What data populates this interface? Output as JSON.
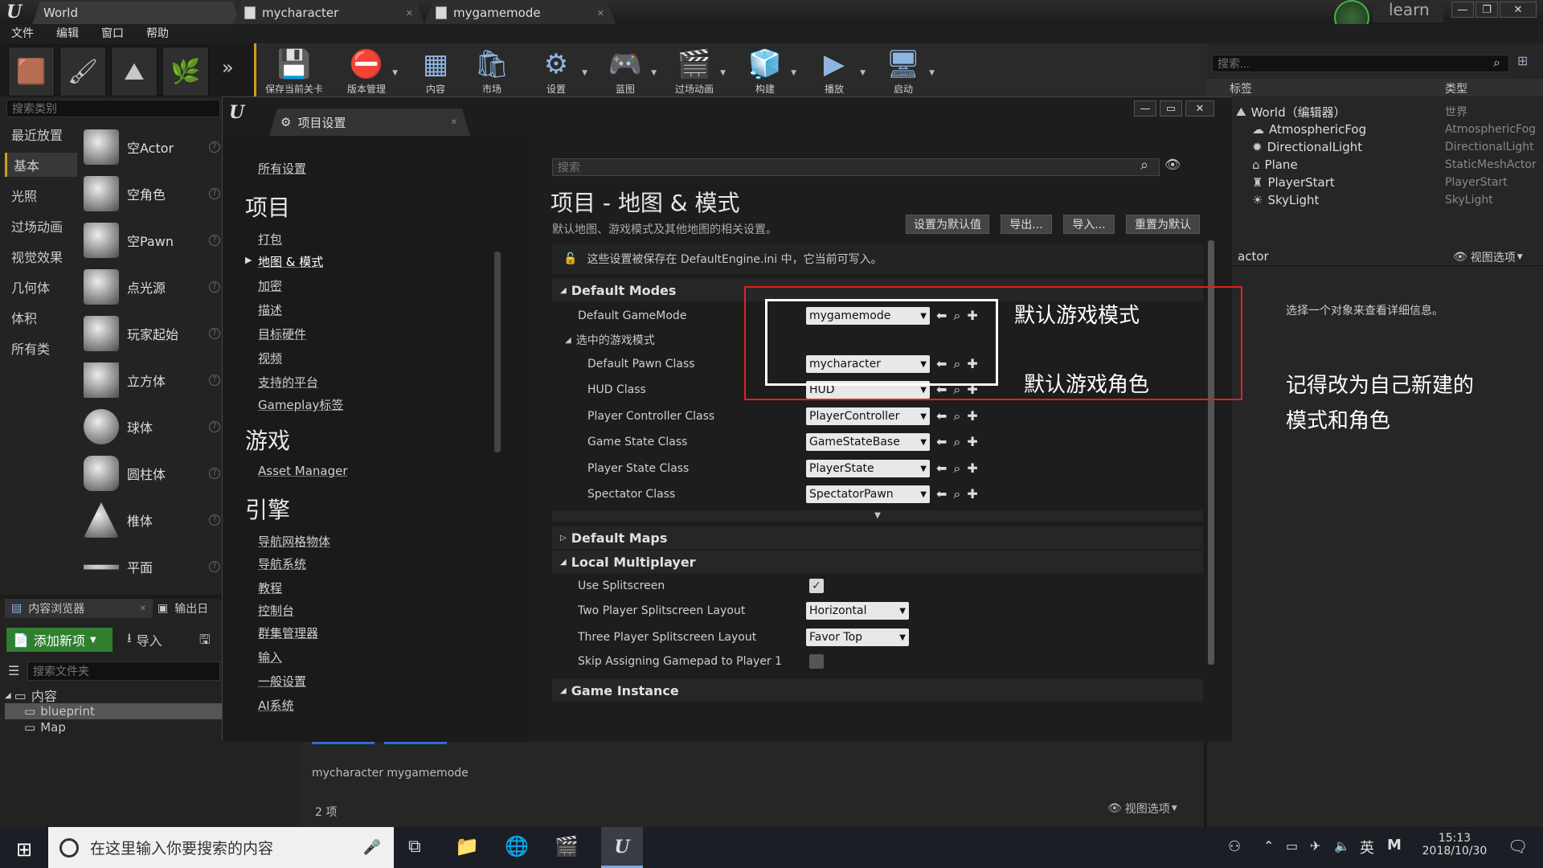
{
  "titlebar": {
    "tabs": [
      "World",
      "mycharacter",
      "mygamemode"
    ],
    "learn": "learn"
  },
  "menu": [
    "文件",
    "编辑",
    "窗口",
    "帮助"
  ],
  "toolbar": {
    "buttons": [
      "保存当前关卡",
      "版本管理",
      "内容",
      "市场",
      "设置",
      "蓝图",
      "过场动画",
      "构建",
      "播放",
      "启动"
    ]
  },
  "left": {
    "search_placeholder": "搜索类别",
    "categories": [
      "最近放置",
      "基本",
      "光照",
      "过场动画",
      "视觉效果",
      "几何体",
      "体积",
      "所有类"
    ],
    "items": [
      "空Actor",
      "空角色",
      "空Pawn",
      "点光源",
      "玩家起始",
      "立方体",
      "球体",
      "圆柱体",
      "椎体",
      "平面"
    ]
  },
  "content": {
    "tabs": [
      "内容浏览器",
      "输出日"
    ],
    "add_new": "添加新项",
    "import": "导入",
    "search_placeholder": "搜索文件夹",
    "tree": {
      "root": "内容",
      "children": [
        "blueprint",
        "Map"
      ]
    },
    "assets": "mycharacter  mygamemode",
    "count": "2 项",
    "view_options": "视图选项"
  },
  "outliner": {
    "search_placeholder": "搜索...",
    "col_label": "标签",
    "col_type": "类型",
    "rows": [
      {
        "label": "World（编辑器）",
        "type": "世界"
      },
      {
        "label": "AtmosphericFog",
        "type": "AtmosphericFog"
      },
      {
        "label": "DirectionalLight",
        "type": "DirectionalLight"
      },
      {
        "label": "Plane",
        "type": "StaticMeshActor"
      },
      {
        "label": "PlayerStart",
        "type": "PlayerStart"
      },
      {
        "label": "SkyLight",
        "type": "SkyLight"
      }
    ],
    "footer_left": "actor",
    "footer_right": "视图选项"
  },
  "details": {
    "hint": "选择一个对象来查看详细信息。",
    "annotation": "记得改为自己新建的\n模式和角色"
  },
  "modal": {
    "tab": "项目设置",
    "all_settings": "所有设置",
    "nav": [
      {
        "head": "项目",
        "links": [
          "打包",
          "地图 & 模式",
          "加密",
          "描述",
          "目标硬件",
          "视频",
          "支持的平台",
          "Gameplay标签"
        ]
      },
      {
        "head": "游戏",
        "links": [
          "Asset Manager"
        ]
      },
      {
        "head": "引擎",
        "links": [
          "导航网格物体",
          "导航系统",
          "教程",
          "控制台",
          "群集管理器",
          "输入",
          "一般设置",
          "AI系统"
        ]
      }
    ],
    "search_placeholder": "搜索",
    "title": "项目 - 地图 & 模式",
    "subtitle": "默认地图、游戏模式及其他地图的相关设置。",
    "buttons": [
      "设置为默认值",
      "导出...",
      "导入...",
      "重置为默认"
    ],
    "notice": "这些设置被保存在 DefaultEngine.ini 中，它当前可写入。",
    "default_modes": "Default Modes",
    "default_gamemode_label": "Default GameMode",
    "default_gamemode": "mygamemode",
    "selected_mode": "选中的游戏模式",
    "class_rows": [
      {
        "label": "Default Pawn Class",
        "value": "mycharacter"
      },
      {
        "label": "HUD Class",
        "value": "HUD"
      },
      {
        "label": "Player Controller Class",
        "value": "PlayerController"
      },
      {
        "label": "Game State Class",
        "value": "GameStateBase"
      },
      {
        "label": "Player State Class",
        "value": "PlayerState"
      },
      {
        "label": "Spectator Class",
        "value": "SpectatorPawn"
      }
    ],
    "default_maps": "Default Maps",
    "local_multiplayer": "Local Multiplayer",
    "use_splitscreen": "Use Splitscreen",
    "two_player": "Two Player Splitscreen Layout",
    "two_player_value": "Horizontal",
    "three_player": "Three Player Splitscreen Layout",
    "three_player_value": "Favor Top",
    "skip_gamepad": "Skip Assigning Gamepad to Player 1",
    "game_instance": "Game Instance",
    "annot_mode": "默认游戏模式",
    "annot_char": "默认游戏角色"
  },
  "taskbar": {
    "search": "在这里输入你要搜索的内容",
    "ime": "英",
    "time": "15:13",
    "date": "2018/10/30"
  },
  "colors": {
    "annotation_red": "#e02020",
    "annotation_white": "#ffffff",
    "accent_gold": "#c8a020"
  }
}
